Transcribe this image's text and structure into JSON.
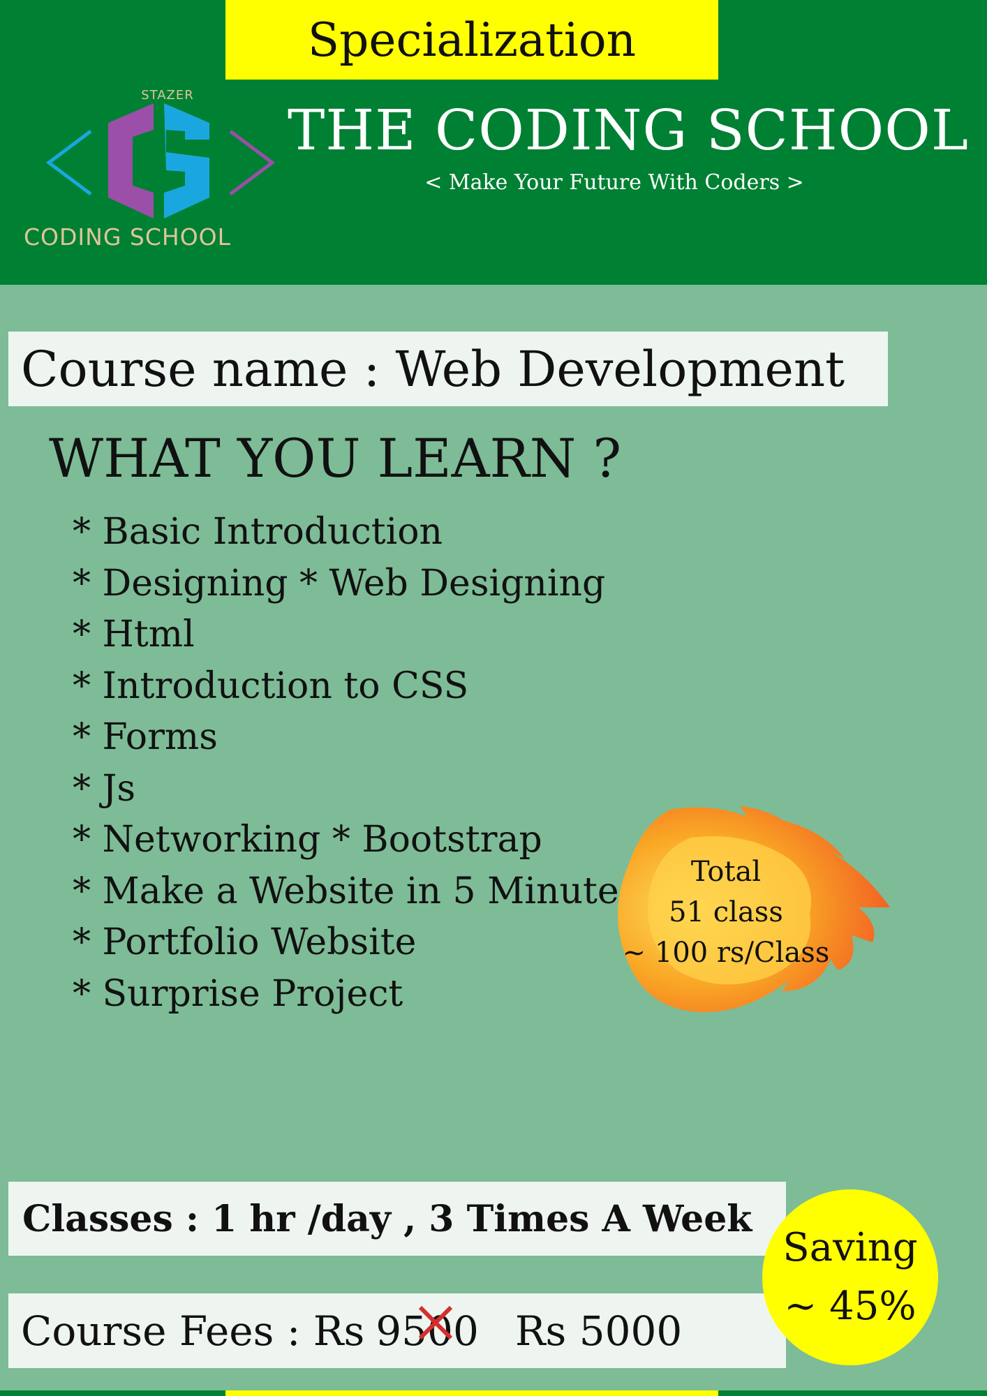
{
  "header": {
    "specialization": "Specialization",
    "title": "THE CODING SCHOOL",
    "tagline": "< Make Your Future With Coders >",
    "logo": {
      "top_text": "STAZER",
      "bottom_text": "CODING SCHOOL",
      "icon": "cs-logo-icon"
    }
  },
  "course": {
    "label": "Course name : Web Development"
  },
  "learn": {
    "heading": "WHAT YOU LEARN ?",
    "items": [
      "* Basic Introduction",
      "*  Designing  * Web Designing",
      "* Html",
      "* Introduction to CSS",
      "* Forms",
      "* Js",
      "* Networking    * Bootstrap",
      "*  Make a Website in 5 Minutes",
      "* Portfolio Website",
      "* Surprise Project"
    ]
  },
  "badge": {
    "line1": "Total",
    "line2": "51 class",
    "line3": "~ 100 rs/Class",
    "icon": "fire-icon"
  },
  "classes": {
    "label": "Classes : 1 hr /day , 3 Times A Week"
  },
  "fees": {
    "label": "Course Fees : Rs",
    "old_price": "9500",
    "new_price": "Rs 5000"
  },
  "saving": {
    "line1": "Saving",
    "line2": "~ 45%"
  },
  "colors": {
    "header_green": "#008033",
    "body_green": "#7dbc97",
    "yellow": "#ffff00",
    "panel": "#eef5f0"
  }
}
